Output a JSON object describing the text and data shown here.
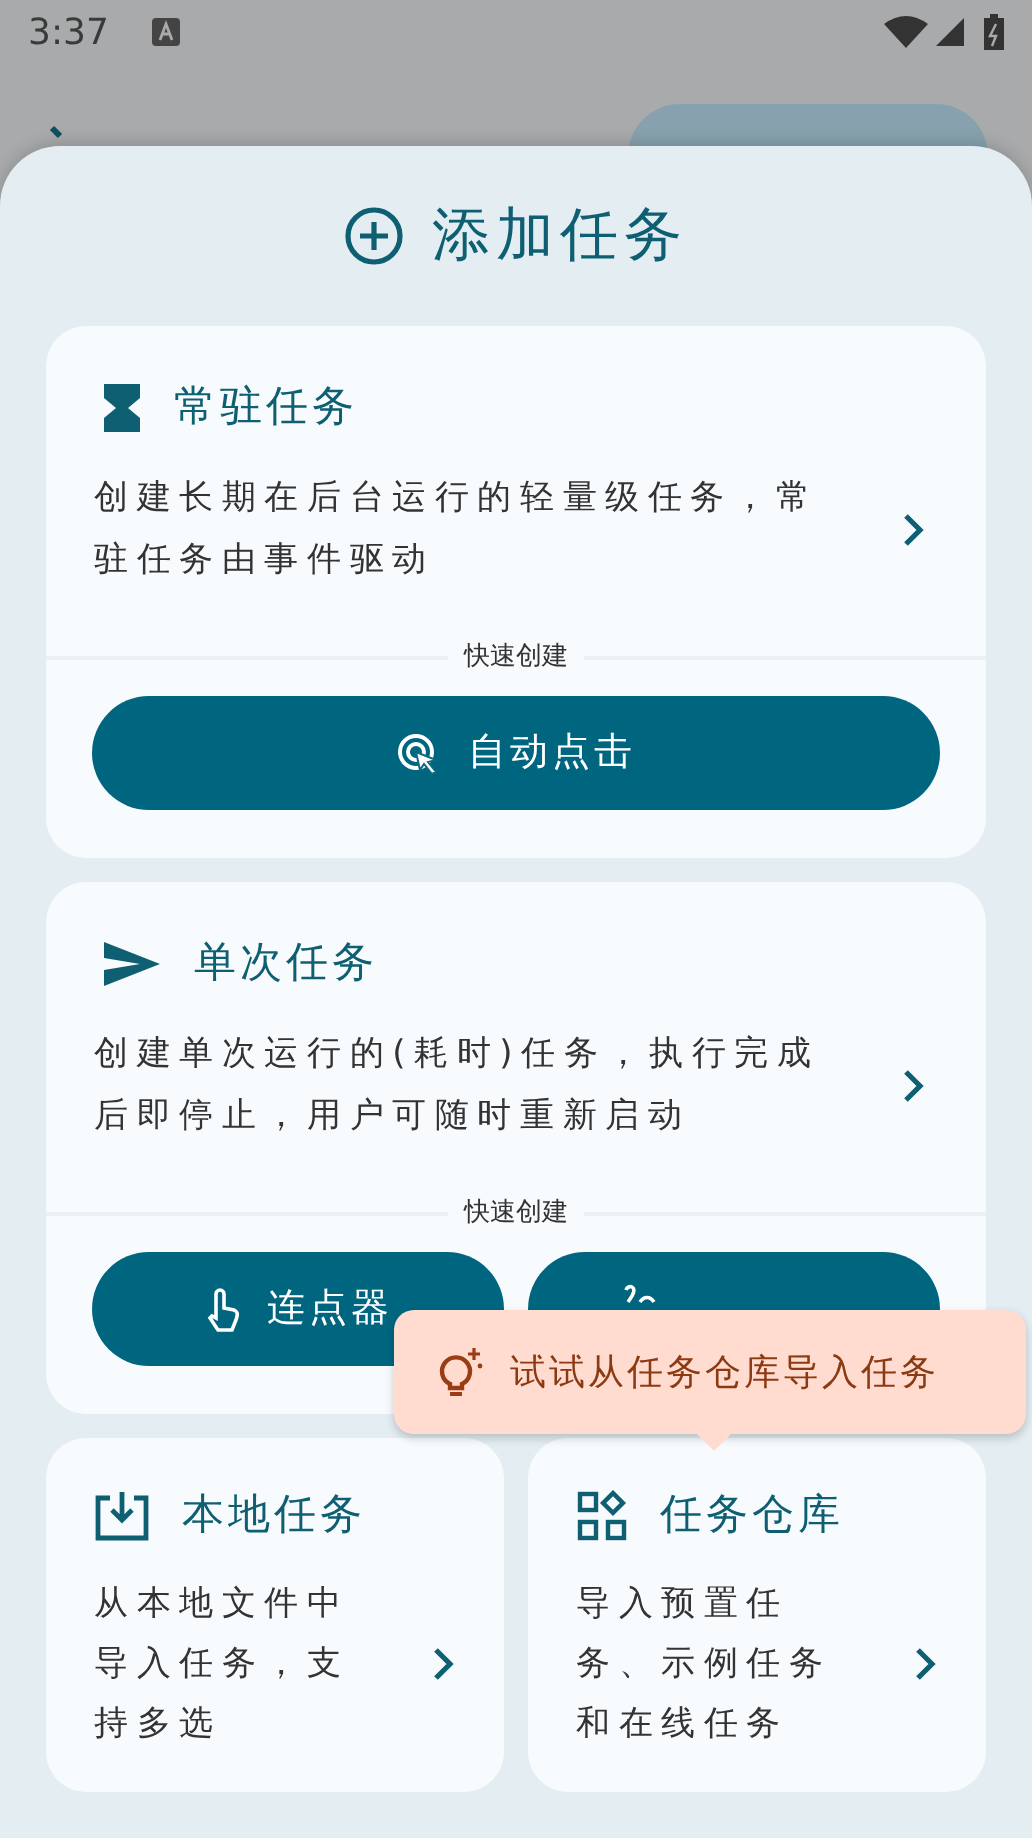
{
  "status_bar": {
    "time": "3:37"
  },
  "sheet": {
    "title": "添加任务",
    "task_types": [
      {
        "title": "常驻任务",
        "description": "创建长期在后台运行的轻量级任务，常驻任务由事件驱动",
        "quick_label": "快速创建",
        "quick_actions": [
          {
            "kind": "click",
            "label": "自动点击"
          }
        ]
      },
      {
        "title": "单次任务",
        "description": "创建单次运行的(耗时)任务，执行完成后即停止，用户可随时重新启动",
        "quick_label": "快速创建",
        "quick_actions": [
          {
            "kind": "tap",
            "label": "连点器"
          },
          {
            "kind": "gesture"
          }
        ]
      }
    ],
    "sources": [
      {
        "title": "本地任务",
        "description": "从本地文件中导入任务，支持多选"
      },
      {
        "title": "任务仓库",
        "description": "导入预置任务、示例任务和在线任务"
      }
    ],
    "tooltip": "试试从任务仓库导入任务"
  }
}
